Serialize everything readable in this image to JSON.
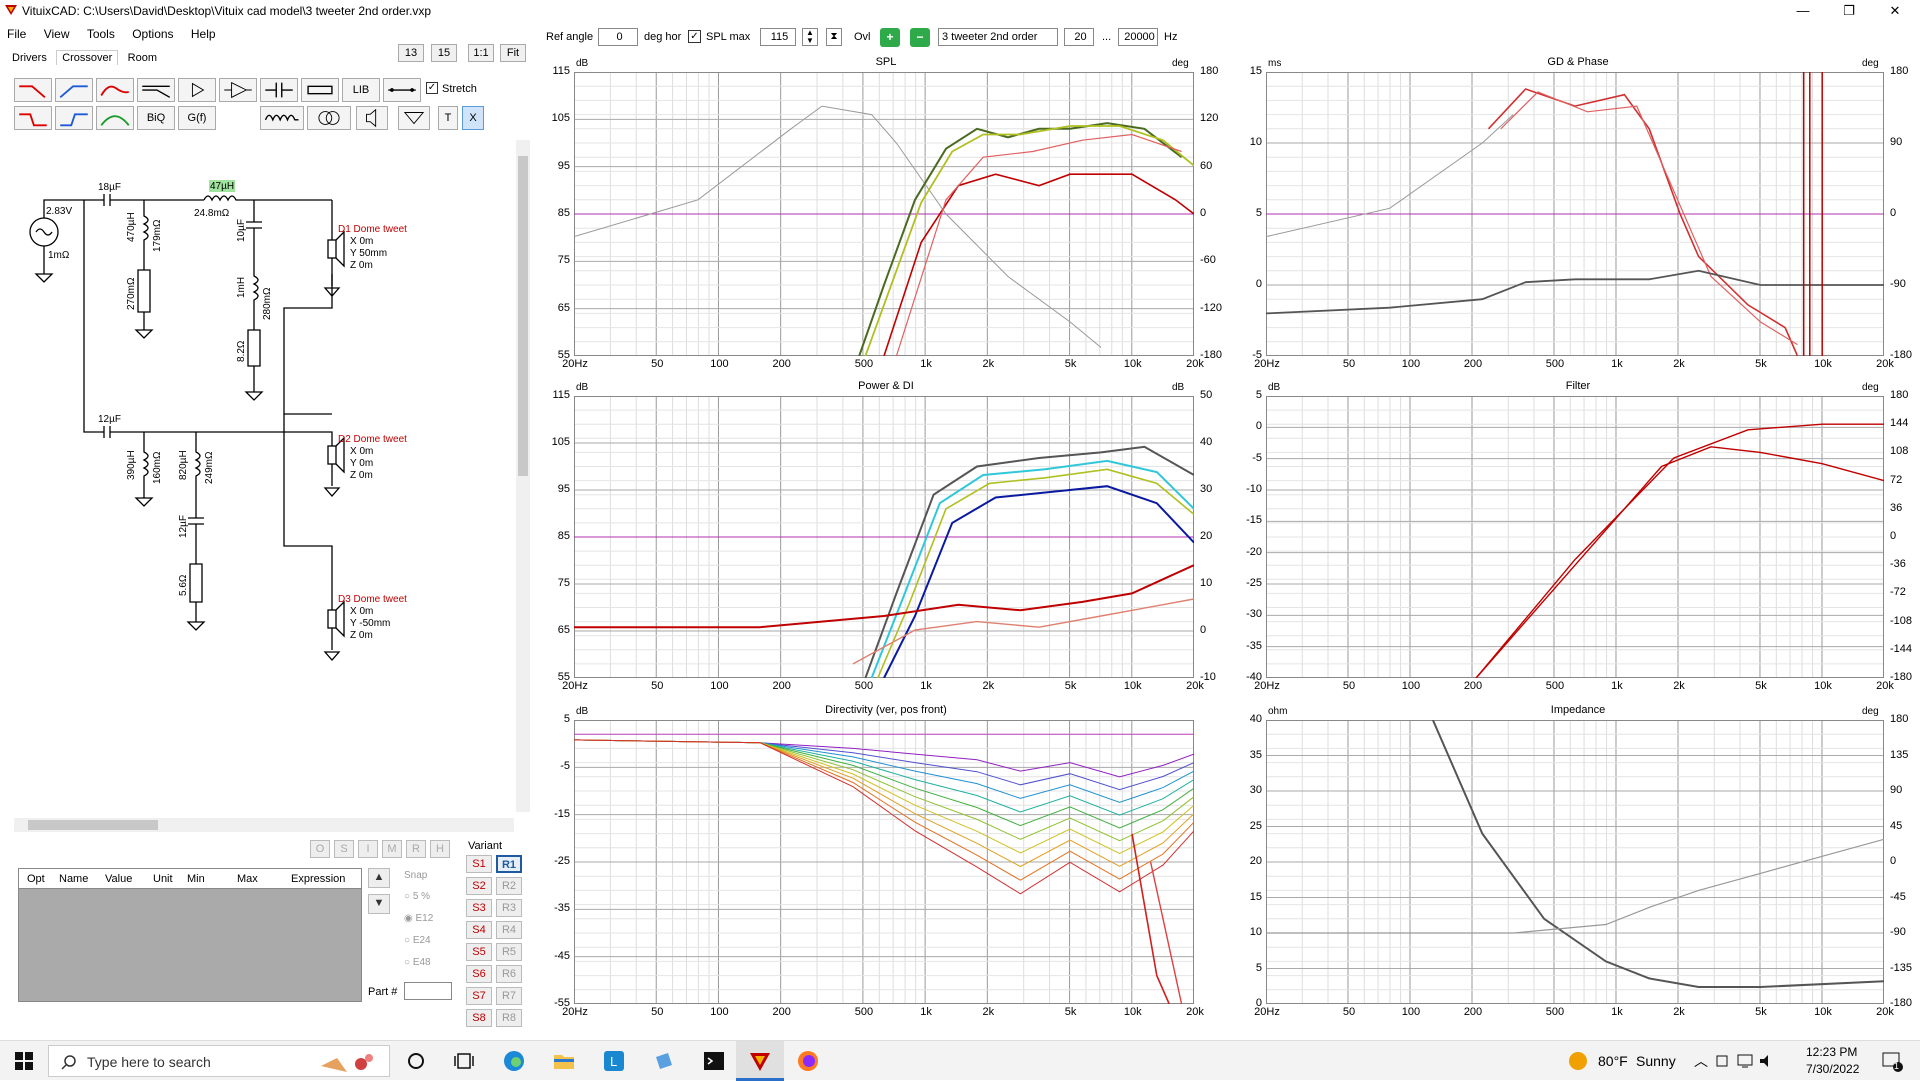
{
  "window": {
    "title": "VituixCAD: C:\\Users\\David\\Desktop\\Vituix cad model\\3 tweeter 2nd order.vxp",
    "minimize": "—",
    "maximize": "❐",
    "close": "✕"
  },
  "menu": [
    "File",
    "View",
    "Tools",
    "Options",
    "Help"
  ],
  "tabs": [
    "Drivers",
    "Crossover",
    "Room"
  ],
  "left_top_buttons": [
    "13",
    "15",
    "1:1",
    "Fit"
  ],
  "toolbar": {
    "lib": "LIB",
    "biq": "BiQ",
    "gf": "G(f)",
    "t": "T",
    "x": "X",
    "stretch": "Stretch"
  },
  "schematic": {
    "source_voltage": "2.83V",
    "source_res": "1mΩ",
    "c1": "18µF",
    "l_series": "47µH",
    "l_series_res": "24.8mΩ",
    "l_shunt1": "470µH",
    "l_shunt1_res": "179mΩ",
    "r_shunt1": "270mΩ",
    "c_shunt2": "10µF",
    "l_shunt2": "1mH",
    "l_shunt2_res": "280mΩ",
    "r_shunt2": "8.2Ω",
    "c2": "12µF",
    "l3": "390µH",
    "l3_res": "160mΩ",
    "l4": "820µH",
    "l4_res": "249mΩ",
    "c3": "12µF",
    "r3": "5.6Ω",
    "drivers": [
      {
        "name": "D1 Dome tweet",
        "x": "X 0m",
        "y": "Y 50mm",
        "z": "Z 0m"
      },
      {
        "name": "D2 Dome tweet",
        "x": "X 0m",
        "y": "Y 0m",
        "z": "Z 0m"
      },
      {
        "name": "D3 Dome tweet",
        "x": "X 0m",
        "y": "Y -50mm",
        "z": "Z 0m"
      }
    ]
  },
  "optimizer": {
    "columns": [
      "Opt",
      "Name",
      "Value",
      "Unit",
      "Min",
      "Max",
      "Expression"
    ],
    "flags": [
      "O",
      "S",
      "I",
      "M",
      "R",
      "H"
    ],
    "snap_label": "Snap",
    "snap_options": [
      "5 %",
      "E12",
      "E24",
      "E48"
    ],
    "part_label": "Part #",
    "variant_label": "Variant",
    "s_buttons": [
      "S1",
      "S2",
      "S3",
      "S4",
      "S5",
      "S6",
      "S7",
      "S8"
    ],
    "r_buttons": [
      "R1",
      "R2",
      "R3",
      "R4",
      "R5",
      "R6",
      "R7",
      "R8"
    ]
  },
  "top_controls": {
    "ref_angle_label": "Ref angle",
    "ref_angle": "0",
    "deg_hor": "deg hor",
    "spl_max_label": "SPL max",
    "spl_max": "115",
    "ovl": "Ovl",
    "overlay_name": "3 tweeter 2nd order",
    "fmin": "20",
    "dots": "...",
    "fmax": "20000",
    "hz": "Hz"
  },
  "x_ticks": [
    "20Hz",
    "50",
    "100",
    "200",
    "500",
    "1k",
    "2k",
    "5k",
    "10k",
    "20k"
  ],
  "charts": {
    "spl": {
      "title": "SPL",
      "left_unit": "dB",
      "right_unit": "deg",
      "left_ticks": [
        "115",
        "105",
        "95",
        "85",
        "75",
        "65",
        "55"
      ],
      "right_ticks": [
        "180",
        "120",
        "60",
        "0",
        "-60",
        "-120",
        "-180"
      ]
    },
    "gd": {
      "title": "GD & Phase",
      "left_unit": "ms",
      "right_unit": "deg",
      "left_ticks": [
        "15",
        "10",
        "5",
        "0",
        "-5"
      ],
      "right_ticks": [
        "180",
        "90",
        "0",
        "-90",
        "-180"
      ]
    },
    "power": {
      "title": "Power & DI",
      "left_unit": "dB",
      "right_unit": "dB",
      "left_ticks": [
        "115",
        "105",
        "95",
        "85",
        "75",
        "65",
        "55"
      ],
      "right_ticks": [
        "50",
        "40",
        "30",
        "20",
        "10",
        "0",
        "-10"
      ]
    },
    "filter": {
      "title": "Filter",
      "left_unit": "dB",
      "right_unit": "deg",
      "left_ticks": [
        "5",
        "0",
        "-5",
        "-10",
        "-15",
        "-20",
        "-25",
        "-30",
        "-35",
        "-40"
      ],
      "right_ticks": [
        "180",
        "144",
        "108",
        "72",
        "36",
        "0",
        "-36",
        "-72",
        "-108",
        "-144",
        "-180"
      ]
    },
    "directivity": {
      "title": "Directivity (ver, pos front)",
      "left_unit": "dB",
      "right_unit": "",
      "left_ticks": [
        "5",
        "-5",
        "-15",
        "-25",
        "-35",
        "-45",
        "-55"
      ],
      "right_ticks": []
    },
    "impedance": {
      "title": "Impedance",
      "left_unit": "ohm",
      "right_unit": "deg",
      "left_ticks": [
        "40",
        "35",
        "30",
        "25",
        "20",
        "15",
        "10",
        "5",
        "0"
      ],
      "right_ticks": [
        "180",
        "135",
        "90",
        "45",
        "0",
        "-45",
        "-90",
        "-135",
        "-180"
      ]
    }
  },
  "taskbar": {
    "search_placeholder": "Type here to search",
    "weather_temp": "80°F",
    "weather_desc": "Sunny",
    "time": "12:23 PM",
    "date": "7/30/2022",
    "notif_count": "1"
  },
  "colors": {
    "accent_red": "#c00000",
    "purple_ref": "#b030b0",
    "grid": "#cccccc"
  }
}
